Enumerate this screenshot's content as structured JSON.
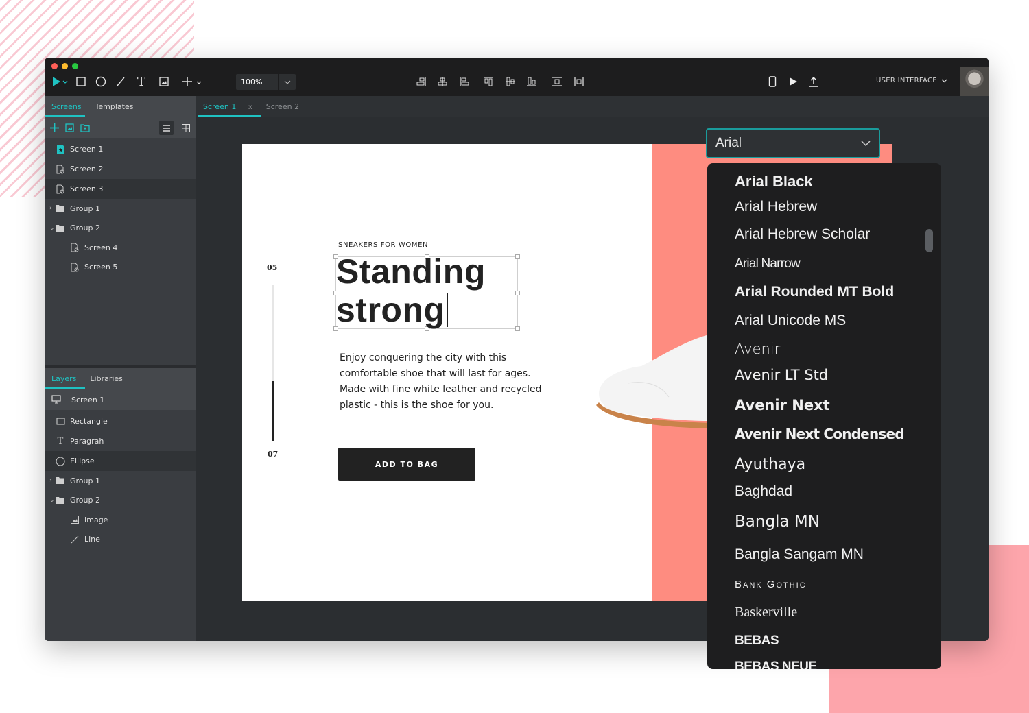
{
  "colors": {
    "accent": "#1fc2c2",
    "salmon": "#fe8c80",
    "pink": "#fda5ab",
    "dark": "#1d1d1e"
  },
  "window": {
    "traffic_lights": [
      "#fe5f57",
      "#febc2e",
      "#28c840"
    ]
  },
  "toolbar": {
    "tools": [
      "select-tool",
      "rectangle-tool",
      "ellipse-tool",
      "line-tool",
      "text-tool",
      "image-tool",
      "add-tool"
    ],
    "zoom_value": "100%",
    "align_tools": [
      "align-right",
      "align-horizontal-center",
      "align-left",
      "align-top",
      "align-vertical-center",
      "align-bottom",
      "distribute-vertical",
      "distribute-horizontal"
    ],
    "right_tools": [
      "device-preview",
      "play",
      "export"
    ],
    "mode_label": "USER INTERFACE"
  },
  "screens_panel": {
    "tabs": [
      "Screens",
      "Templates"
    ],
    "items": [
      {
        "label": "Screen 1",
        "type": "screen-main"
      },
      {
        "label": "Screen 2",
        "type": "screen"
      },
      {
        "label": "Screen 3",
        "type": "screen"
      },
      {
        "label": "Group 1",
        "type": "group",
        "collapsed": true
      },
      {
        "label": "Group 2",
        "type": "group",
        "collapsed": false
      },
      {
        "label": "Screen 4",
        "type": "screen",
        "indent": true
      },
      {
        "label": "Screen 5",
        "type": "screen",
        "indent": true
      }
    ]
  },
  "layers_panel": {
    "tabs": [
      "Layers",
      "Libraries"
    ],
    "root": "Screen 1",
    "items": [
      {
        "label": "Rectangle",
        "type": "rectangle"
      },
      {
        "label": "Paragrah",
        "type": "text"
      },
      {
        "label": "Ellipse",
        "type": "ellipse"
      },
      {
        "label": "Group 1",
        "type": "group",
        "collapsed": true
      },
      {
        "label": "Group 2",
        "type": "group",
        "collapsed": false
      },
      {
        "label": "Image",
        "type": "image",
        "indent": true
      },
      {
        "label": "Line",
        "type": "line",
        "indent": true
      }
    ]
  },
  "canvas_tabs": [
    {
      "label": "Screen 1",
      "active": true,
      "close": "x"
    },
    {
      "label": "Screen 2",
      "active": false
    }
  ],
  "artboard": {
    "eyebrow": "SNEAKERS FOR WOMEN",
    "headline_1": "Standing",
    "headline_2": "strong",
    "body": [
      "Enjoy conquering the city with this",
      "comfortable shoe that will last for ages.",
      "Made with fine white leather and recycled",
      "plastic - this is the shoe for you."
    ],
    "counter_top": "05",
    "counter_bottom": "07",
    "progress": 0.38,
    "cta": "ADD TO BAG"
  },
  "font_picker": {
    "selected": "Arial",
    "options": [
      "Arial Black",
      "Arial Hebrew",
      "Arial Hebrew Scholar",
      "Arial Narrow",
      "Arial Rounded MT Bold",
      "Arial Unicode MS",
      "Avenir",
      "Avenir LT Std",
      "Avenir Next",
      "Avenir Next Condensed",
      "Ayuthaya",
      "Baghdad",
      "Bangla MN",
      "Bangla Sangam MN",
      "Bank Gothic",
      "Baskerville",
      "BEBAS",
      "BEBAS NEUE"
    ]
  }
}
